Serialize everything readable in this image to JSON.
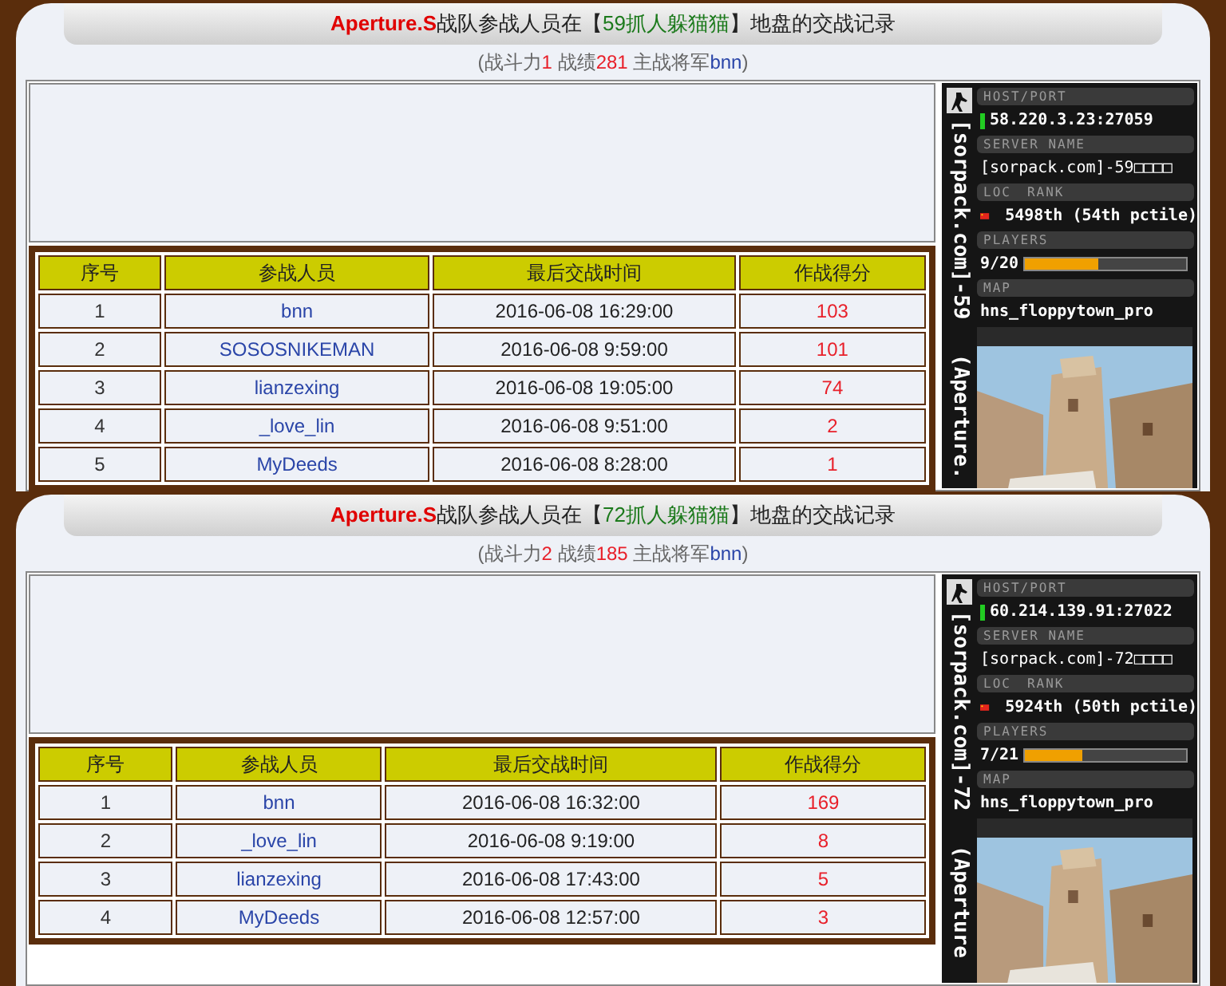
{
  "sections": [
    {
      "title": [
        {
          "text": "Aperture.S",
          "kind": "team"
        },
        {
          "text": "战队参战人员在【",
          "kind": "plain"
        },
        {
          "text": "59抓人躲猫猫",
          "kind": "map"
        },
        {
          "text": "】地盘的交战记录",
          "kind": "plain"
        }
      ],
      "stats": [
        {
          "text": "(战斗力",
          "kind": "plain"
        },
        {
          "text": "1",
          "kind": "red"
        },
        {
          "text": " 战绩",
          "kind": "plain"
        },
        {
          "text": "281",
          "kind": "red"
        },
        {
          "text": " 主战将军",
          "kind": "plain"
        },
        {
          "text": "bnn",
          "kind": "blue"
        },
        {
          "text": ")",
          "kind": "plain"
        }
      ],
      "columns": [
        "序号",
        "参战人员",
        "最后交战时间",
        "作战得分"
      ],
      "rows": [
        {
          "no": "1",
          "player": "bnn",
          "time": "2016-06-08 16:29:00",
          "score": "103"
        },
        {
          "no": "2",
          "player": "SOSOSNIKEMAN",
          "time": "2016-06-08 9:59:00",
          "score": "101"
        },
        {
          "no": "3",
          "player": "lianzexing",
          "time": "2016-06-08 19:05:00",
          "score": "74"
        },
        {
          "no": "4",
          "player": "_love_lin",
          "time": "2016-06-08 9:51:00",
          "score": "2"
        },
        {
          "no": "5",
          "player": "MyDeeds",
          "time": "2016-06-08 8:28:00",
          "score": "1"
        }
      ],
      "server": {
        "side_name": "[sorpack.com]-59",
        "side_team": "(Aperture.",
        "host_label": "HOST/PORT",
        "host": "58.220.3.23:27059",
        "name_label": "SERVER NAME",
        "name": "[sorpack.com]-59□□□□",
        "loc_label": "LOC",
        "rank_label": "RANK",
        "rank": "5498th (54th pctile)",
        "players_label": "PLAYERS",
        "players": "9/20",
        "level": 0.45,
        "map_label": "MAP",
        "map": "hns_floppytown_pro"
      }
    },
    {
      "title": [
        {
          "text": "Aperture.S",
          "kind": "team"
        },
        {
          "text": "战队参战人员在【",
          "kind": "plain"
        },
        {
          "text": "72抓人躲猫猫",
          "kind": "map"
        },
        {
          "text": "】地盘的交战记录",
          "kind": "plain"
        }
      ],
      "stats": [
        {
          "text": "(战斗力",
          "kind": "plain"
        },
        {
          "text": "2",
          "kind": "red"
        },
        {
          "text": " 战绩",
          "kind": "plain"
        },
        {
          "text": "185",
          "kind": "red"
        },
        {
          "text": " 主战将军",
          "kind": "plain"
        },
        {
          "text": "bnn",
          "kind": "blue"
        },
        {
          "text": ")",
          "kind": "plain"
        }
      ],
      "columns": [
        "序号",
        "参战人员",
        "最后交战时间",
        "作战得分"
      ],
      "rows": [
        {
          "no": "1",
          "player": "bnn",
          "time": "2016-06-08 16:32:00",
          "score": "169"
        },
        {
          "no": "2",
          "player": "_love_lin",
          "time": "2016-06-08 9:19:00",
          "score": "8"
        },
        {
          "no": "3",
          "player": "lianzexing",
          "time": "2016-06-08 17:43:00",
          "score": "5"
        },
        {
          "no": "4",
          "player": "MyDeeds",
          "time": "2016-06-08 12:57:00",
          "score": "3"
        }
      ],
      "server": {
        "side_name": "[sorpack.com]-72",
        "side_team": "(Aperture",
        "host_label": "HOST/PORT",
        "host": "60.214.139.91:27022",
        "name_label": "SERVER NAME",
        "name": "[sorpack.com]-72□□□□",
        "loc_label": "LOC",
        "rank_label": "RANK",
        "rank": "5924th (50th pctile)",
        "players_label": "PLAYERS",
        "players": "7/21",
        "level": 0.36,
        "map_label": "MAP",
        "map": "hns_floppytown_pro"
      }
    }
  ]
}
